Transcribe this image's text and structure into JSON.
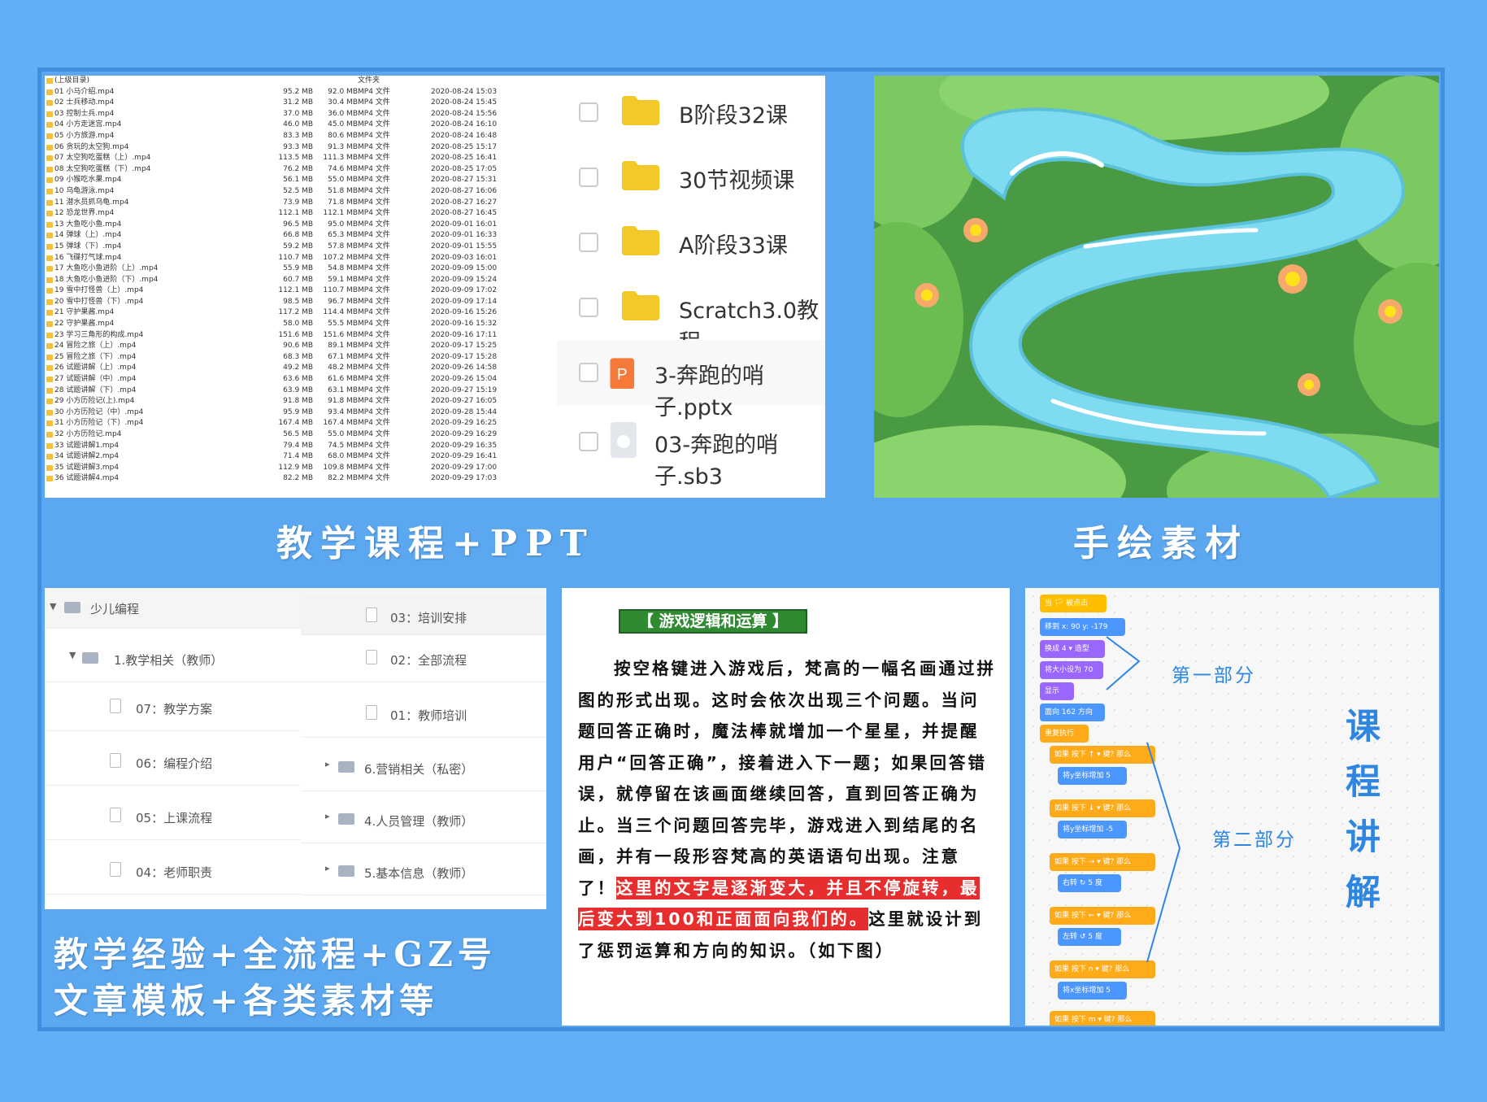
{
  "captions": {
    "files": "教学课程+PPT",
    "art": "手绘素材",
    "tree_line1": "教学经验+全流程+GZ号",
    "tree_line2": "文章模板+各类素材等",
    "scratch_vertical": [
      "课",
      "程",
      "讲",
      "解"
    ]
  },
  "file_list": {
    "parent": "(上级目录)",
    "parent_type": "文件夹",
    "rows": [
      {
        "name": "01 小马介绍.mp4",
        "s1": "95.2 MB",
        "s2": "92.0 MB",
        "type": "MP4 文件",
        "date": "2020-08-24 15:03"
      },
      {
        "name": "02 士兵移动.mp4",
        "s1": "31.2 MB",
        "s2": "30.4 MB",
        "type": "MP4 文件",
        "date": "2020-08-24 15:45"
      },
      {
        "name": "03 控制士兵.mp4",
        "s1": "37.0 MB",
        "s2": "36.0 MB",
        "type": "MP4 文件",
        "date": "2020-08-24 15:56"
      },
      {
        "name": "04 小方走迷宫.mp4",
        "s1": "46.0 MB",
        "s2": "45.0 MB",
        "type": "MP4 文件",
        "date": "2020-08-24 16:10"
      },
      {
        "name": "05 小方旅游.mp4",
        "s1": "83.3 MB",
        "s2": "80.6 MB",
        "type": "MP4 文件",
        "date": "2020-08-24 16:48"
      },
      {
        "name": "06 贪玩的太空狗.mp4",
        "s1": "93.3 MB",
        "s2": "91.3 MB",
        "type": "MP4 文件",
        "date": "2020-08-25 15:17"
      },
      {
        "name": "07 太空狗吃蛋糕（上）.mp4",
        "s1": "113.5 MB",
        "s2": "111.3 MB",
        "type": "MP4 文件",
        "date": "2020-08-25 16:41"
      },
      {
        "name": "08 太空狗吃蛋糕（下）.mp4",
        "s1": "76.2 MB",
        "s2": "74.6 MB",
        "type": "MP4 文件",
        "date": "2020-08-25 17:05"
      },
      {
        "name": "09 小猴吃水果.mp4",
        "s1": "56.1 MB",
        "s2": "55.0 MB",
        "type": "MP4 文件",
        "date": "2020-08-27 15:31"
      },
      {
        "name": "10 乌龟游泳.mp4",
        "s1": "52.5 MB",
        "s2": "51.8 MB",
        "type": "MP4 文件",
        "date": "2020-08-27 16:06"
      },
      {
        "name": "11 潜水员抓乌龟.mp4",
        "s1": "73.9 MB",
        "s2": "71.8 MB",
        "type": "MP4 文件",
        "date": "2020-08-27 16:27"
      },
      {
        "name": "12 恐龙世界.mp4",
        "s1": "112.1 MB",
        "s2": "112.1 MB",
        "type": "MP4 文件",
        "date": "2020-08-27 16:45"
      },
      {
        "name": "13 大鱼吃小鱼.mp4",
        "s1": "96.5 MB",
        "s2": "95.0 MB",
        "type": "MP4 文件",
        "date": "2020-09-01 16:01"
      },
      {
        "name": "14 弹球（上）.mp4",
        "s1": "66.8 MB",
        "s2": "65.3 MB",
        "type": "MP4 文件",
        "date": "2020-09-01 16:33"
      },
      {
        "name": "15 弹球（下）.mp4",
        "s1": "59.2 MB",
        "s2": "57.8 MB",
        "type": "MP4 文件",
        "date": "2020-09-01 15:55"
      },
      {
        "name": "16 飞碟打气球.mp4",
        "s1": "110.7 MB",
        "s2": "107.2 MB",
        "type": "MP4 文件",
        "date": "2020-09-03 16:01"
      },
      {
        "name": "17 大鱼吃小鱼进阶（上）.mp4",
        "s1": "55.9 MB",
        "s2": "54.8 MB",
        "type": "MP4 文件",
        "date": "2020-09-09 15:00"
      },
      {
        "name": "18 大鱼吃小鱼进阶（下）.mp4",
        "s1": "60.7 MB",
        "s2": "59.1 MB",
        "type": "MP4 文件",
        "date": "2020-09-09 15:24"
      },
      {
        "name": "19 雪中打怪兽（上）.mp4",
        "s1": "112.1 MB",
        "s2": "110.7 MB",
        "type": "MP4 文件",
        "date": "2020-09-09 17:02"
      },
      {
        "name": "20 雪中打怪兽（下）.mp4",
        "s1": "98.5 MB",
        "s2": "96.7 MB",
        "type": "MP4 文件",
        "date": "2020-09-09 17:14"
      },
      {
        "name": "21 守护果酱.mp4",
        "s1": "117.2 MB",
        "s2": "114.4 MB",
        "type": "MP4 文件",
        "date": "2020-09-16 15:26"
      },
      {
        "name": "22 守护果酱.mp4",
        "s1": "58.0 MB",
        "s2": "55.5 MB",
        "type": "MP4 文件",
        "date": "2020-09-16 15:32"
      },
      {
        "name": "23 学习三角形的构成.mp4",
        "s1": "151.6 MB",
        "s2": "151.6 MB",
        "type": "MP4 文件",
        "date": "2020-09-16 17:11"
      },
      {
        "name": "24 冒险之旅（上）.mp4",
        "s1": "90.6 MB",
        "s2": "89.1 MB",
        "type": "MP4 文件",
        "date": "2020-09-17 15:25"
      },
      {
        "name": "25 冒险之旅（下）.mp4",
        "s1": "68.3 MB",
        "s2": "67.1 MB",
        "type": "MP4 文件",
        "date": "2020-09-17 15:28"
      },
      {
        "name": "26 试题讲解（上）.mp4",
        "s1": "49.2 MB",
        "s2": "48.2 MB",
        "type": "MP4 文件",
        "date": "2020-09-26 14:58"
      },
      {
        "name": "27 试题讲解（中）.mp4",
        "s1": "63.6 MB",
        "s2": "61.6 MB",
        "type": "MP4 文件",
        "date": "2020-09-26 15:04"
      },
      {
        "name": "28 试题讲解（下）.mp4",
        "s1": "63.9 MB",
        "s2": "63.1 MB",
        "type": "MP4 文件",
        "date": "2020-09-27 15:19"
      },
      {
        "name": "29 小方历险记(上).mp4",
        "s1": "91.8 MB",
        "s2": "91.8 MB",
        "type": "MP4 文件",
        "date": "2020-09-27 16:05"
      },
      {
        "name": "30 小方历险记（中）.mp4",
        "s1": "95.9 MB",
        "s2": "93.4 MB",
        "type": "MP4 文件",
        "date": "2020-09-28 15:44"
      },
      {
        "name": "31 小方历险记（下）.mp4",
        "s1": "167.4 MB",
        "s2": "167.4 MB",
        "type": "MP4 文件",
        "date": "2020-09-29 16:25"
      },
      {
        "name": "32 小方历险记.mp4",
        "s1": "56.5 MB",
        "s2": "55.0 MB",
        "type": "MP4 文件",
        "date": "2020-09-29 16:29"
      },
      {
        "name": "33 试题讲解1.mp4",
        "s1": "79.4 MB",
        "s2": "74.5 MB",
        "type": "MP4 文件",
        "date": "2020-09-29 16:35"
      },
      {
        "name": "34 试题讲解2.mp4",
        "s1": "71.4 MB",
        "s2": "68.0 MB",
        "type": "MP4 文件",
        "date": "2020-09-29 16:41"
      },
      {
        "name": "35 试题讲解3.mp4",
        "s1": "112.9 MB",
        "s2": "109.8 MB",
        "type": "MP4 文件",
        "date": "2020-09-29 17:00"
      },
      {
        "name": "36 试题讲解4.mp4",
        "s1": "82.2 MB",
        "s2": "82.2 MB",
        "type": "MP4 文件",
        "date": "2020-09-29 17:03"
      }
    ]
  },
  "folders": [
    {
      "label": "B阶段32课",
      "kind": "folder"
    },
    {
      "label": "30节视频课",
      "kind": "folder"
    },
    {
      "label": "A阶段33课",
      "kind": "folder"
    },
    {
      "label": "Scratch3.0教程",
      "kind": "folder"
    },
    {
      "label": "3-奔跑的哨子.pptx",
      "kind": "ppt"
    },
    {
      "label": "03-奔跑的哨子.sb3",
      "kind": "sb3"
    }
  ],
  "tree": {
    "root": "少儿编程",
    "sub": "1.教学相关（教师）",
    "left_docs": [
      "07：教学方案",
      "06：编程介绍",
      "05：上课流程",
      "04：老师职责"
    ],
    "right_docs": [
      "03：培训安排",
      "02：全部流程",
      "01：教师培训"
    ],
    "right_folders": [
      "6.营销相关（私密）",
      "4.人员管理（教师）",
      "5.基本信息（教师）"
    ]
  },
  "text_page": {
    "tag": "【 游戏逻辑和运算 】",
    "para_before": "按空格键进入游戏后，梵高的一幅名画通过拼图的形式出现。这时会依次出现三个问题。当问题回答正确时，魔法棒就增加一个星星，并提醒用户“回答正确”，接着进入下一题；如果回答错误，就停留在该画面继续回答，直到回答正确为止。当三个问题回答完毕，游戏进入到结尾的名画，并有一段形容梵高的英语语句出现。注意了！",
    "para_highlight": "这里的文字是逐渐变大，并且不停旋转，最后变大到100和正面面向我们的。",
    "para_after": "这里就设计到了惩罚运算和方向的知识。（如下图）"
  },
  "scratch": {
    "part1": "第一部分",
    "part2": "第二部分",
    "blocks": {
      "when_flag": "当 🏳 被点击",
      "goto": "移到 x: 90 y: -179",
      "costume": "换成 4 ▾ 造型",
      "size": "将大小设为 70",
      "show": "显示",
      "direction": "面向 162 方向",
      "forever": "重复执行",
      "if1": "如果 按下 ↑ ▾ 键? 那么",
      "inner1": "将y坐标增加 5",
      "if2": "如果 按下 ↓ ▾ 键? 那么",
      "inner2": "将y坐标增加 -5",
      "if3": "如果 按下 → ▾ 键? 那么",
      "inner3": "右转 ↻ 5 度",
      "if4": "如果 按下 ← ▾ 键? 那么",
      "inner4": "左转 ↺ 5 度",
      "if5": "如果 按下 n ▾ 键? 那么",
      "inner5": "将x坐标增加 5",
      "if6": "如果 按下 m ▾ 键? 那么"
    }
  },
  "colors": {
    "background": "#62aff5",
    "frame_border": "#3f8ee0",
    "folder_yellow": "#f5c82a",
    "highlight_red": "#e62e2e",
    "tag_green": "#2f8a32",
    "scratch_blue": "#2f86e0"
  }
}
